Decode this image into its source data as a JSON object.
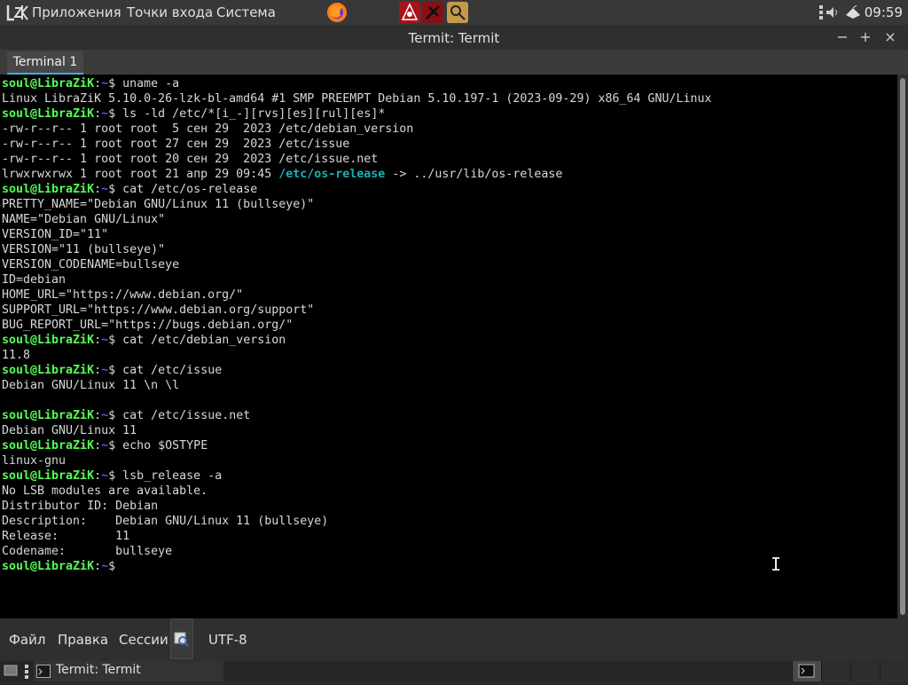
{
  "top_panel": {
    "logo": "LZK",
    "menus": [
      "Приложения",
      "Точки входа",
      "Система"
    ],
    "launchers": [
      "firefox-icon",
      "app-icon-red-1",
      "app-icon-red-2",
      "app-icon-orange"
    ],
    "clock": "09:59"
  },
  "window": {
    "title": "Termit: Termit",
    "buttons": {
      "minimize": "−",
      "maximize": "+",
      "close": "×"
    }
  },
  "tabs": [
    {
      "label": "Terminal 1",
      "active": true
    }
  ],
  "terminal": {
    "prompt": {
      "user_host": "soul@LibraZiK",
      "sep": ":",
      "path": "~",
      "symbol": "$"
    },
    "lines": [
      {
        "type": "prompt",
        "cmd": " uname -a"
      },
      {
        "type": "out",
        "text": "Linux LibraZiK 5.10.0-26-lzk-bl-amd64 #1 SMP PREEMPT Debian 5.10.197-1 (2023-09-29) x86_64 GNU/Linux"
      },
      {
        "type": "prompt",
        "cmd": " ls -ld /etc/*[i_-][rvs][es][rul][es]*"
      },
      {
        "type": "out",
        "text": "-rw-r--r-- 1 root root  5 сен 29  2023 /etc/debian_version"
      },
      {
        "type": "out",
        "text": "-rw-r--r-- 1 root root 27 сен 29  2023 /etc/issue"
      },
      {
        "type": "out",
        "text": "-rw-r--r-- 1 root root 20 сен 29  2023 /etc/issue.net"
      },
      {
        "type": "link",
        "pre": "lrwxrwxrwx 1 root root 21 апр 29 09:45 ",
        "link": "/etc/os-release",
        "post": " -> ../usr/lib/os-release"
      },
      {
        "type": "prompt",
        "cmd": " cat /etc/os-release"
      },
      {
        "type": "out",
        "text": "PRETTY_NAME=\"Debian GNU/Linux 11 (bullseye)\""
      },
      {
        "type": "out",
        "text": "NAME=\"Debian GNU/Linux\""
      },
      {
        "type": "out",
        "text": "VERSION_ID=\"11\""
      },
      {
        "type": "out",
        "text": "VERSION=\"11 (bullseye)\""
      },
      {
        "type": "out",
        "text": "VERSION_CODENAME=bullseye"
      },
      {
        "type": "out",
        "text": "ID=debian"
      },
      {
        "type": "out",
        "text": "HOME_URL=\"https://www.debian.org/\""
      },
      {
        "type": "out",
        "text": "SUPPORT_URL=\"https://www.debian.org/support\""
      },
      {
        "type": "out",
        "text": "BUG_REPORT_URL=\"https://bugs.debian.org/\""
      },
      {
        "type": "prompt",
        "cmd": " cat /etc/debian_version"
      },
      {
        "type": "out",
        "text": "11.8"
      },
      {
        "type": "prompt",
        "cmd": " cat /etc/issue"
      },
      {
        "type": "out",
        "text": "Debian GNU/Linux 11 \\n \\l"
      },
      {
        "type": "out",
        "text": ""
      },
      {
        "type": "prompt",
        "cmd": " cat /etc/issue.net"
      },
      {
        "type": "out",
        "text": "Debian GNU/Linux 11"
      },
      {
        "type": "prompt",
        "cmd": " echo $OSTYPE"
      },
      {
        "type": "out",
        "text": "linux-gnu"
      },
      {
        "type": "prompt",
        "cmd": " lsb_release -a"
      },
      {
        "type": "out",
        "text": "No LSB modules are available."
      },
      {
        "type": "out",
        "text": "Distributor ID:\tDebian"
      },
      {
        "type": "out",
        "text": "Description:\tDebian GNU/Linux 11 (bullseye)"
      },
      {
        "type": "out",
        "text": "Release:\t11"
      },
      {
        "type": "out",
        "text": "Codename:\tbullseye"
      },
      {
        "type": "prompt",
        "cmd": ""
      }
    ]
  },
  "menubar": {
    "file": "Файл",
    "edit": "Правка",
    "sessions": "Сессии",
    "encoding": "UTF-8"
  },
  "taskbar": {
    "task_label": "Termit: Termit"
  },
  "colors": {
    "prompt_user": "#54ff54",
    "prompt_path": "#5454ff",
    "link": "#18b2b2",
    "accent": "#3daee9"
  }
}
